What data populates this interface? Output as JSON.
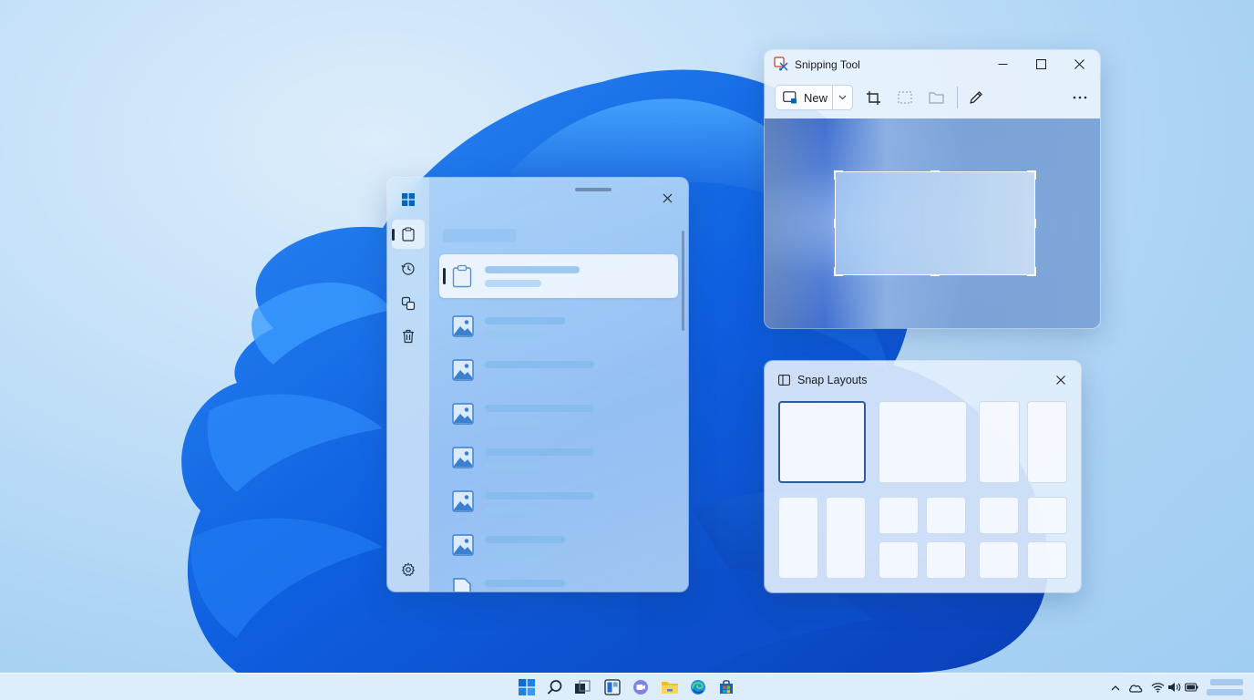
{
  "snipping_tool": {
    "title": "Snipping Tool",
    "new_label": "New"
  },
  "snap_layouts": {
    "title": "Snap Layouts"
  },
  "clipboard": {
    "items": [
      {
        "icon": "clipboard-icon"
      },
      {
        "icon": "image-icon"
      },
      {
        "icon": "image-icon"
      },
      {
        "icon": "image-icon"
      },
      {
        "icon": "image-icon"
      },
      {
        "icon": "image-icon"
      },
      {
        "icon": "image-icon"
      },
      {
        "icon": "file-icon"
      }
    ]
  },
  "colors": {
    "accent": "#0067c0",
    "active_border": "#2e5c96"
  }
}
